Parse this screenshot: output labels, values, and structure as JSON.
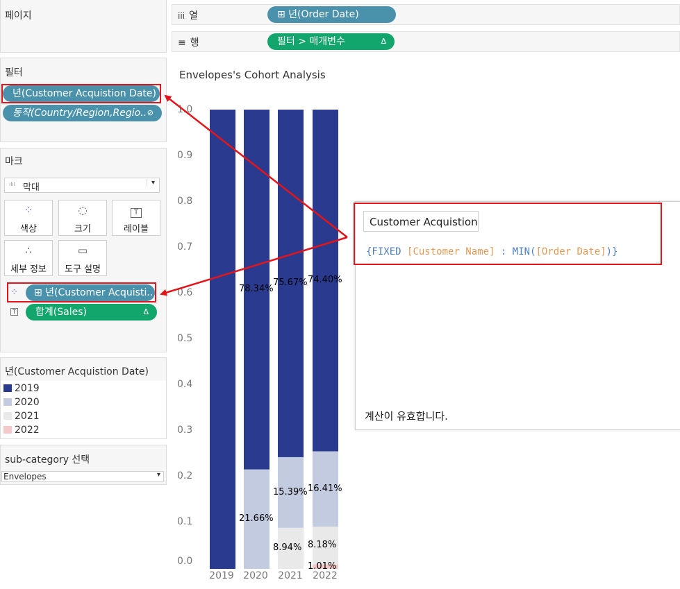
{
  "pages_panel": {
    "title": "페이지"
  },
  "shelves": {
    "columns": {
      "icon": "iii",
      "label": "열",
      "pill": "⊞ 년(Order Date)"
    },
    "rows": {
      "icon": "≡",
      "label": "행",
      "pill": "필터 > 매개변수",
      "pill_icon": "Δ"
    }
  },
  "filters_panel": {
    "title": "필터",
    "items": [
      {
        "label": "년(Customer Acquistion Date)"
      },
      {
        "label": "동작(Country/Region,Regio..",
        "icon": "⊘"
      }
    ]
  },
  "marks_panel": {
    "title": "마크",
    "mark_type": {
      "icon": "ılıl",
      "value": "막대",
      "dropdown": "▾"
    },
    "buttons": [
      {
        "icon": "⁘",
        "label": "색상"
      },
      {
        "icon": "◌",
        "label": "크기"
      },
      {
        "icon": "T",
        "label": "레이블"
      },
      {
        "icon": "∴",
        "label": "세부 정보"
      },
      {
        "icon": "▭",
        "label": "도구 설명"
      }
    ],
    "fields": [
      {
        "type_icon": "⁘",
        "label": "⊞ 년(Customer Acquisti.."
      },
      {
        "type_icon": "T",
        "label": "합계(Sales)",
        "delta": "Δ"
      }
    ]
  },
  "legend": {
    "title": "년(Customer Acquistion Date)",
    "items": [
      {
        "label": "2019",
        "color": "#2a3a8f"
      },
      {
        "label": "2020",
        "color": "#c3cbe0"
      },
      {
        "label": "2021",
        "color": "#e9e9e9"
      },
      {
        "label": "2022",
        "color": "#f4c9c9"
      }
    ]
  },
  "parameter": {
    "title": "sub-category 선택",
    "value": "Envelopes",
    "dropdown": "▾"
  },
  "chart": {
    "title": "Envelopes's Cohort Analysis",
    "y_ticks": [
      "1.0",
      "0.9",
      "0.8",
      "0.7",
      "0.6",
      "0.5",
      "0.4",
      "0.3",
      "0.2",
      "0.1",
      "0.0"
    ]
  },
  "chart_data": {
    "type": "bar",
    "stacked": true,
    "title": "Envelopes's Cohort Analysis",
    "categories": [
      "2019",
      "2020",
      "2021",
      "2022"
    ],
    "ylim": [
      0,
      1.0
    ],
    "series": [
      {
        "name": "2019",
        "color": "#2a3a8f",
        "values": [
          1.0,
          0.7834,
          0.7567,
          0.744
        ]
      },
      {
        "name": "2020",
        "color": "#c3cbe0",
        "values": [
          0,
          0.2166,
          0.1539,
          0.1641
        ]
      },
      {
        "name": "2021",
        "color": "#e9e9e9",
        "values": [
          0,
          0,
          0.0894,
          0.0818
        ]
      },
      {
        "name": "2022",
        "color": "#f4c9c9",
        "values": [
          0,
          0,
          0,
          0.0101
        ]
      }
    ],
    "labels": [
      [
        "",
        "78.34%",
        "75.67%",
        "74.40%"
      ],
      [
        "",
        "21.66%",
        "15.39%",
        "16.41%"
      ],
      [
        "",
        "",
        "8.94%",
        "8.18%"
      ],
      [
        "",
        "",
        "",
        "1.01%"
      ]
    ]
  },
  "calc_editor": {
    "name": "Customer Acquistion",
    "formula": {
      "open": "{FIXED",
      "field1": "[Customer Name]",
      "colon": ":",
      "func": "MIN(",
      "field2": "[Order Date]",
      "close": ")}"
    },
    "status": "계산이 유효합니다."
  },
  "colors": {
    "accent_red": "#e3151a",
    "pill_blue": "#4a92ab",
    "pill_green": "#12a56c"
  }
}
